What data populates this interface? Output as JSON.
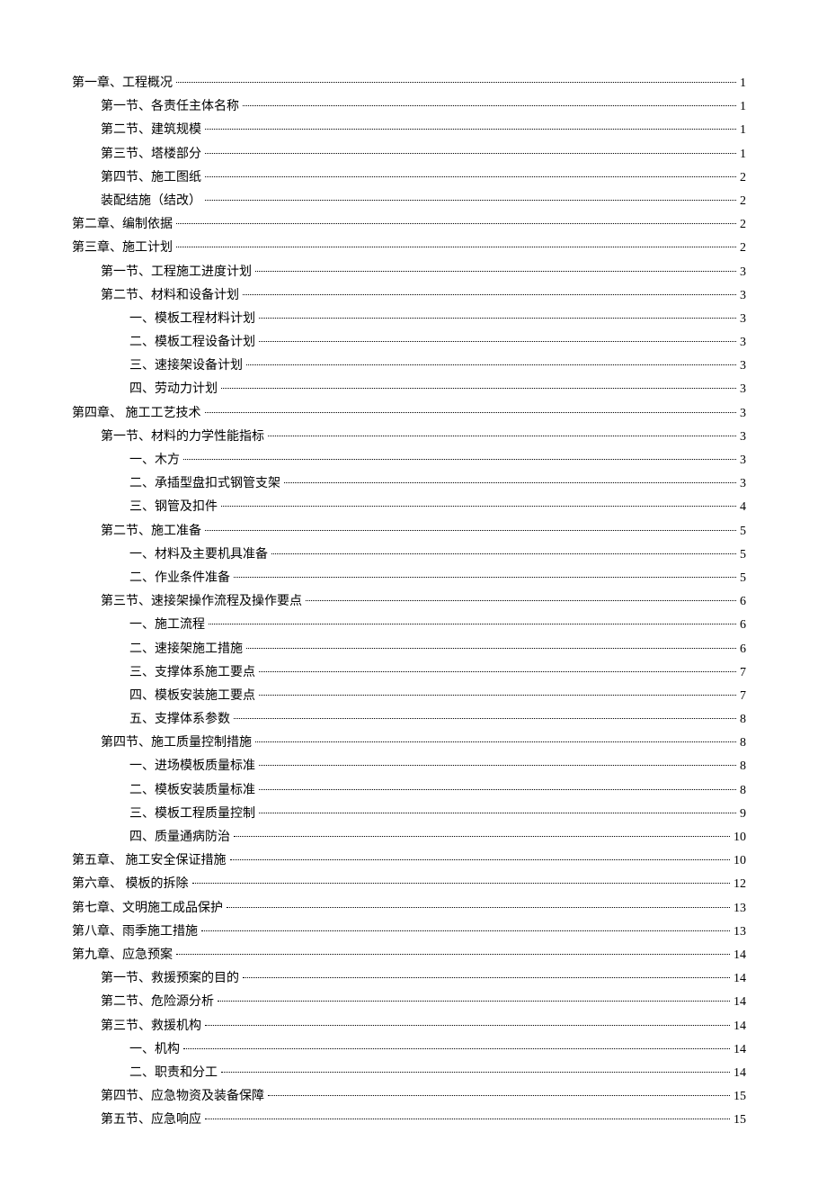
{
  "toc": [
    {
      "level": 0,
      "label": "第一章、工程概况",
      "page": "1"
    },
    {
      "level": 1,
      "label": "第一节、各责任主体名称",
      "page": "1"
    },
    {
      "level": 1,
      "label": "第二节、建筑规模",
      "page": "1"
    },
    {
      "level": 1,
      "label": "第三节、塔楼部分",
      "page": "1"
    },
    {
      "level": 1,
      "label": "第四节、施工图纸",
      "page": "2"
    },
    {
      "level": 1,
      "label": "装配结施（结改）",
      "page": "2"
    },
    {
      "level": 0,
      "label": "第二章、编制依据",
      "page": "2"
    },
    {
      "level": 0,
      "label": "第三章、施工计划",
      "page": "2"
    },
    {
      "level": 1,
      "label": "第一节、工程施工进度计划",
      "page": "3"
    },
    {
      "level": 1,
      "label": "第二节、材料和设备计划",
      "page": "3"
    },
    {
      "level": 2,
      "label": "一、模板工程材料计划",
      "page": "3"
    },
    {
      "level": 2,
      "label": "二、模板工程设备计划",
      "page": "3"
    },
    {
      "level": 2,
      "label": "三、速接架设备计划",
      "page": "3"
    },
    {
      "level": 2,
      "label": "四、劳动力计划",
      "page": "3"
    },
    {
      "level": 0,
      "label": "第四章、 施工工艺技术",
      "page": "3"
    },
    {
      "level": 1,
      "label": "第一节、材料的力学性能指标",
      "page": "3"
    },
    {
      "level": 2,
      "label": "一、木方",
      "page": "3"
    },
    {
      "level": 2,
      "label": "二、承插型盘扣式钢管支架",
      "page": "3"
    },
    {
      "level": 2,
      "label": "三、钢管及扣件",
      "page": "4"
    },
    {
      "level": 1,
      "label": "第二节、施工准备",
      "page": "5"
    },
    {
      "level": 2,
      "label": "一、材料及主要机具准备",
      "page": "5"
    },
    {
      "level": 2,
      "label": "二、作业条件准备",
      "page": "5"
    },
    {
      "level": 1,
      "label": "第三节、速接架操作流程及操作要点",
      "page": "6"
    },
    {
      "level": 2,
      "label": "一、施工流程",
      "page": "6"
    },
    {
      "level": 2,
      "label": "二、速接架施工措施",
      "page": "6"
    },
    {
      "level": 2,
      "label": "三、支撑体系施工要点",
      "page": "7"
    },
    {
      "level": 2,
      "label": "四、模板安装施工要点",
      "page": "7"
    },
    {
      "level": 2,
      "label": "五、支撑体系参数",
      "page": "8"
    },
    {
      "level": 1,
      "label": "第四节、施工质量控制措施",
      "page": "8"
    },
    {
      "level": 2,
      "label": "一、进场模板质量标准",
      "page": "8"
    },
    {
      "level": 2,
      "label": "二、模板安装质量标准",
      "page": "8"
    },
    {
      "level": 2,
      "label": "三、模板工程质量控制",
      "page": "9"
    },
    {
      "level": 2,
      "label": "四、质量通病防治",
      "page": "10"
    },
    {
      "level": 0,
      "label": "第五章、 施工安全保证措施",
      "page": "10"
    },
    {
      "level": 0,
      "label": "第六章、 模板的拆除",
      "page": "12"
    },
    {
      "level": 0,
      "label": "第七章、文明施工成品保护",
      "page": "13"
    },
    {
      "level": 0,
      "label": "第八章、雨季施工措施",
      "page": "13"
    },
    {
      "level": 0,
      "label": "第九章、应急预案",
      "page": "14"
    },
    {
      "level": 1,
      "label": "第一节、救援预案的目的",
      "page": "14"
    },
    {
      "level": 1,
      "label": "第二节、危险源分析",
      "page": "14"
    },
    {
      "level": 1,
      "label": "第三节、救援机构",
      "page": "14"
    },
    {
      "level": 2,
      "label": "一、机构",
      "page": "14"
    },
    {
      "level": 2,
      "label": "二、职责和分工",
      "page": "14"
    },
    {
      "level": 1,
      "label": "第四节、应急物资及装备保障",
      "page": "15"
    },
    {
      "level": 1,
      "label": "第五节、应急响应",
      "page": "15"
    }
  ]
}
